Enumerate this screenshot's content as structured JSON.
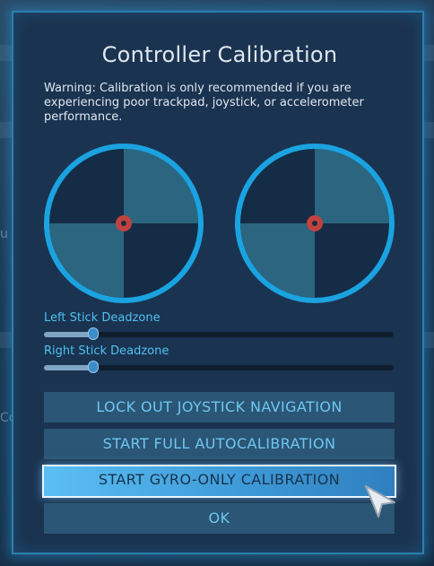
{
  "dialog": {
    "title": "Controller Calibration",
    "warning": "Warning: Calibration is only recommended if you are experiencing poor trackpad, joystick, or accelerometer performance."
  },
  "sliders": [
    {
      "label": "Left Stick Deadzone",
      "value": 0.14
    },
    {
      "label": "Right Stick Deadzone",
      "value": 0.14
    }
  ],
  "buttons": {
    "lock_out": "LOCK OUT JOYSTICK NAVIGATION",
    "full_autocal": "START FULL AUTOCALIBRATION",
    "gyro_only": "START GYRO-ONLY CALIBRATION",
    "ok": "OK"
  },
  "background_fragments": {
    "left_a": "u",
    "left_b": "Co"
  },
  "colors": {
    "accent": "#1aa3e0",
    "quadrant": "#2c6580",
    "dot": "#c0423f",
    "label": "#4fc1f0"
  },
  "icons": [
    "pointer-cursor-icon"
  ]
}
